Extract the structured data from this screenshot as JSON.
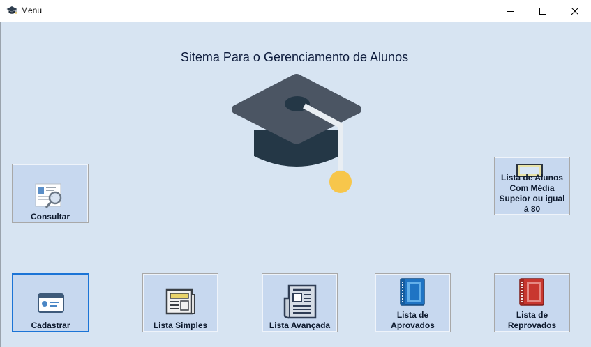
{
  "window": {
    "title": "Menu",
    "controls": {
      "minimize": "minimize-icon",
      "maximize": "maximize-icon",
      "close": "close-icon"
    }
  },
  "main": {
    "heading": "Sitema Para o Gerenciamento de Alunos",
    "logo": "graduation-cap-icon"
  },
  "buttons": {
    "consultar": {
      "label": "Consultar",
      "icon": "id-card-search-icon"
    },
    "media": {
      "label": "Lista de Alunos Com Média Supeior ou igual à 80",
      "icon": "monitor-list-icon"
    },
    "cadastrar": {
      "label": "Cadastrar",
      "icon": "id-card-icon"
    },
    "lista_simples": {
      "label": "Lista Simples",
      "icon": "newspaper-icon"
    },
    "lista_avancada": {
      "label": "Lista Avançada",
      "icon": "newspaper-document-icon"
    },
    "lista_aprovados": {
      "label": "Lista de Aprovados",
      "icon": "blue-book-icon"
    },
    "lista_reprovados": {
      "label": "Lista de Reprovados",
      "icon": "red-book-icon"
    }
  },
  "colors": {
    "background": "#d7e4f2",
    "tile": "#c7d8ef",
    "focus_border": "#1b74d6",
    "cap_top": "#4b5563",
    "cap_base": "#243746",
    "tassel": "#f7c64b"
  }
}
